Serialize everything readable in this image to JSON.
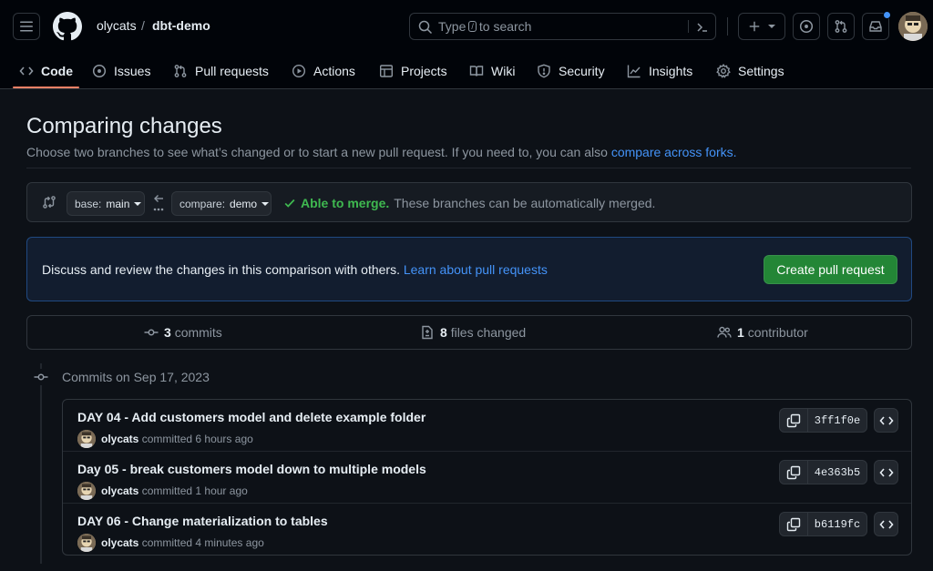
{
  "header": {
    "owner": "olycats",
    "separator": "/",
    "repo": "dbt-demo",
    "search": {
      "prefix": "Type",
      "key": "/",
      "suffix": "to search"
    }
  },
  "nav": {
    "code": "Code",
    "issues": "Issues",
    "pull_requests": "Pull requests",
    "actions": "Actions",
    "projects": "Projects",
    "wiki": "Wiki",
    "security": "Security",
    "insights": "Insights",
    "settings": "Settings"
  },
  "page": {
    "title": "Comparing changes",
    "subtitle": "Choose two branches to see what’s changed or to start a new pull request. If you need to, you can also",
    "subtitle_link": "compare across forks."
  },
  "range": {
    "base_prefix": "base:",
    "base_branch": "main",
    "compare_prefix": "compare:",
    "compare_branch": "demo",
    "merge_status": "Able to merge.",
    "merge_text": "These branches can be automatically merged."
  },
  "flash": {
    "message": "Discuss and review the changes in this comparison with others.",
    "link": "Learn about pull requests",
    "button": "Create pull request"
  },
  "summary": {
    "commits_count": "3",
    "commits_label": "commits",
    "files_count": "8",
    "files_label": "files changed",
    "contributors_count": "1",
    "contributors_label": "contributor"
  },
  "commits": {
    "date_heading": "Commits on Sep 17, 2023",
    "items": [
      {
        "message": "DAY 04 - Add customers model and delete example folder",
        "author": "olycats",
        "verb": "committed",
        "time": "6 hours ago",
        "sha": "3ff1f0e"
      },
      {
        "message": "Day 05 - break customers model down to multiple models",
        "author": "olycats",
        "verb": "committed",
        "time": "1 hour ago",
        "sha": "4e363b5"
      },
      {
        "message": "DAY 06 - Change materialization to tables",
        "author": "olycats",
        "verb": "committed",
        "time": "4 minutes ago",
        "sha": "b6119fc"
      }
    ]
  },
  "colors": {
    "accent_link": "#4493f8",
    "success": "#3fb950",
    "primary_button": "#238636",
    "active_tab_underline": "#f78166",
    "notification_dot": "#4493f8"
  }
}
